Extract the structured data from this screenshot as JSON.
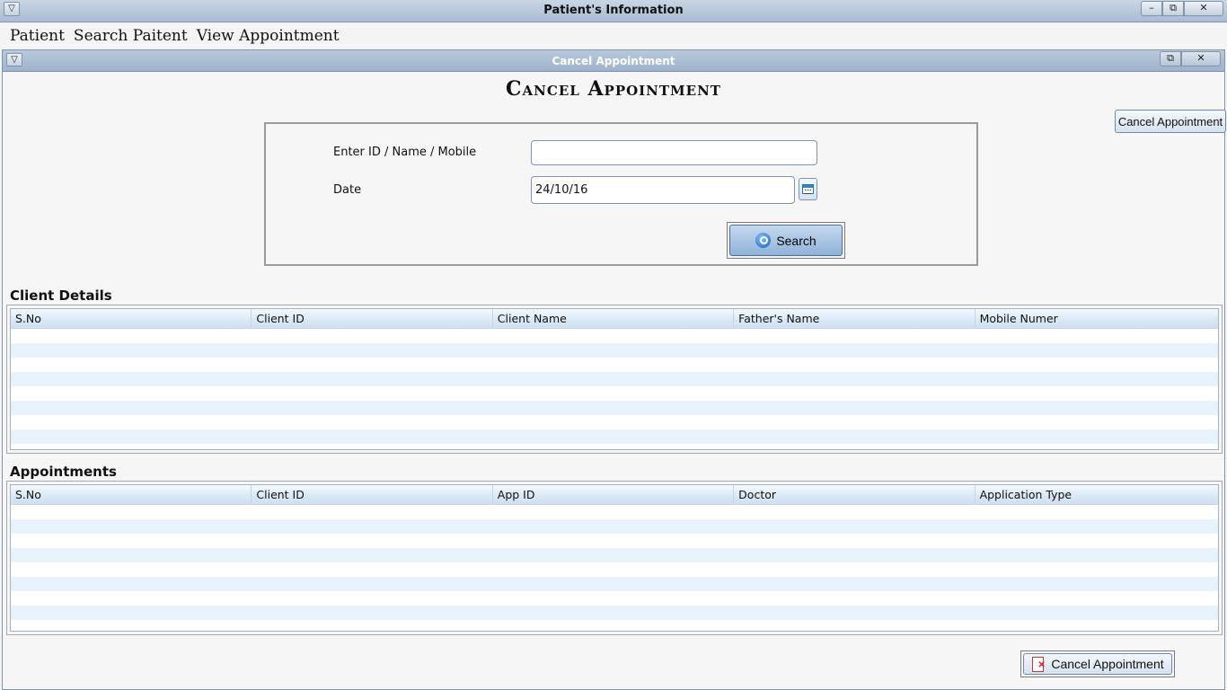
{
  "window": {
    "title": "Patient's Information",
    "sys_menu_icon": "▽",
    "min_icon": "▭",
    "max_icon": "⧉",
    "close_icon": "✕"
  },
  "menubar": {
    "items": [
      "Patient",
      "Search Paitent",
      "View Appointment"
    ]
  },
  "inner_window": {
    "title": "Cancel Appointment",
    "max_icon": "⧉",
    "close_icon": "✕"
  },
  "page": {
    "heading": "Cancel Appointment",
    "top_button": "Cancel Appointment"
  },
  "search_form": {
    "id_label": "Enter ID / Name / Mobile",
    "id_value": "",
    "date_label": "Date",
    "date_value": "24/10/16",
    "calendar_icon": "calendar-icon",
    "search_button": "Search"
  },
  "client_details": {
    "title": "Client Details",
    "columns": [
      "S.No",
      "Client ID",
      "Client Name",
      "Father's Name",
      "Mobile Numer"
    ],
    "rows": []
  },
  "appointments": {
    "title": "Appointments",
    "columns": [
      "S.No",
      "Client ID",
      "App ID",
      "Doctor",
      "Application Type"
    ],
    "rows": []
  },
  "footer": {
    "cancel_button": "Cancel Appointment"
  },
  "colors": {
    "titlebar": "#a9bcd2",
    "header": "#dbe9f6",
    "stripe": "#e8f2fb",
    "accent": "#2a6fb0"
  }
}
